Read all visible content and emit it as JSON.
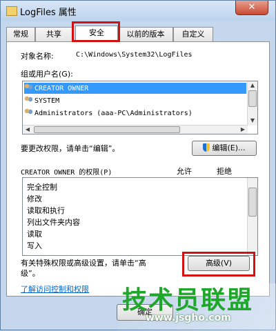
{
  "window": {
    "title": "LogFiles 属性",
    "close_glyph": "✕"
  },
  "tabs": [
    {
      "label": "常规",
      "active": false
    },
    {
      "label": "共享",
      "active": false
    },
    {
      "label": "安全",
      "active": true
    },
    {
      "label": "以前的版本",
      "active": false
    },
    {
      "label": "自定义",
      "active": false
    }
  ],
  "security": {
    "object_name_label": "对象名称:",
    "object_name_value": "C:\\Windows\\System32\\LogFiles",
    "groups_label": "组或用户名(G):",
    "groups": [
      {
        "name": "CREATOR OWNER",
        "selected": true
      },
      {
        "name": "SYSTEM",
        "selected": false
      },
      {
        "name": "Administrators (aaa-PC\\Administrators)",
        "selected": false
      }
    ],
    "edit_hint": "要更改权限，请单击“编辑”。",
    "edit_button": "编辑(E)...",
    "perm_header": "CREATOR OWNER 的权限(P)",
    "allow_header": "允许",
    "deny_header": "拒绝",
    "permissions": [
      "完全控制",
      "修改",
      "读取和执行",
      "列出文件夹内容",
      "读取",
      "写入"
    ],
    "advanced_hint_line1": "有关特殊权限或高级设置，请单击“高",
    "advanced_hint_line2": "级”。",
    "advanced_button": "高级(V)",
    "learn_link": "了解访问控制和权限"
  },
  "footer": {
    "ok_button": "确定"
  },
  "watermark": {
    "text": "技术员联盟",
    "url": "www.jsgho.com"
  }
}
